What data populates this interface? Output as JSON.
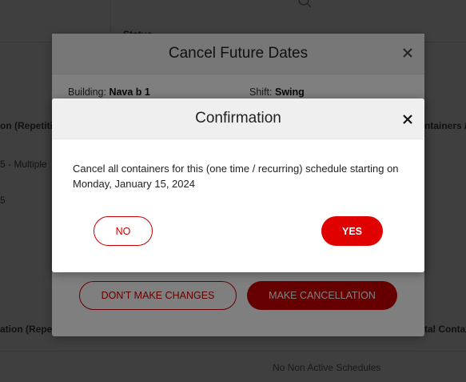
{
  "background_page": {
    "col_status_label": "Status",
    "row_cell_left_1": "on (Repetiti",
    "row_cell_left_2": "5 - Multiple",
    "row_cell_left_3": "5",
    "row_cell_right_1": "ntainers /",
    "row_cell_left_4": "ation (Repeti",
    "row_cell_right_2": "tal Contai",
    "empty_message": "No Non Active Schedules"
  },
  "cancel_modal": {
    "title": "Cancel Future Dates",
    "building_label": "Building:",
    "building_value": "Nava b 1",
    "shift_label": "Shift:",
    "shift_value": "Swing",
    "dont_make_changes": "DON'T MAKE CHANGES",
    "make_cancellation": "MAKE CANCELLATION"
  },
  "confirm_modal": {
    "title": "Confirmation",
    "message": "Cancel all containers for this (one time / recurring) schedule starting on Monday, January 15, 2024",
    "no_label": "NO",
    "yes_label": "YES"
  },
  "colors": {
    "accent": "#cc0000",
    "yes_button": "#e00000",
    "header_bg": "#efefef"
  },
  "icons": {
    "close": "close-icon",
    "search": "search-icon",
    "dropdown": "chevron-down-icon"
  }
}
